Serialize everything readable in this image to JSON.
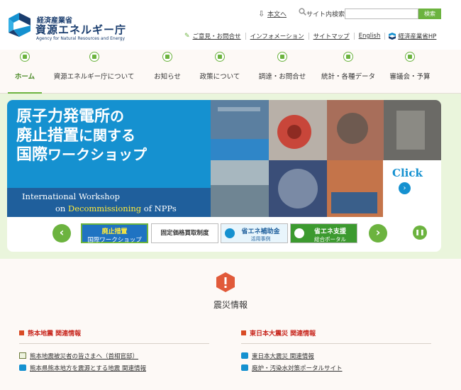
{
  "header": {
    "org_small": "経済産業省",
    "org_main": "資源エネルギー庁",
    "org_en": "Agency for Natural Resources and Energy",
    "skip_link": "本文へ",
    "search_label": "サイト内検索",
    "search_value": "",
    "search_button": "検索"
  },
  "util_links": [
    {
      "label": "ご意見・お問合せ"
    },
    {
      "label": "インフォメーション"
    },
    {
      "label": "サイトマップ"
    },
    {
      "label": "English"
    },
    {
      "label": "経済産業省HP"
    }
  ],
  "nav": [
    {
      "label": "ホーム",
      "active": true
    },
    {
      "label": "資源エネルギー庁について"
    },
    {
      "label": "お知らせ"
    },
    {
      "label": "政策について"
    },
    {
      "label": "調達・お問合せ"
    },
    {
      "label": "統計・各種データ"
    },
    {
      "label": "審議会・予算"
    }
  ],
  "banner": {
    "jp_line1_a": "原子力発電所",
    "jp_line1_b": "の",
    "jp_line2_a": "廃止措置",
    "jp_line2_b": "に関する",
    "jp_line3_a": "国際",
    "jp_line3_b": "ワークショップ",
    "en_line1": "International Workshop",
    "en_line2_a": "on ",
    "en_line2_b": "Decommissioning",
    "en_line2_c": " of NPPs",
    "click_label": "Click"
  },
  "slider": {
    "thumbs": [
      {
        "line1": "廃止措置",
        "line2": "国際ワークショップ"
      },
      {
        "line1": "固定価格買取制度"
      },
      {
        "line1": "省エネ補助金",
        "line2": "活用事例"
      },
      {
        "line1": "省エネ支援",
        "line2": "総合ポータル"
      }
    ]
  },
  "disaster": {
    "title": "震災情報",
    "left": {
      "heading": "熊本地震 関連情報",
      "links": [
        "熊本地震被災者の皆さまへ（首相官邸）",
        "熊本県熊本地方を震源とする地震 関連情報"
      ]
    },
    "right": {
      "heading": "東日本大震災 関連情報",
      "links": [
        "東日本大震災 関連情報",
        "廃炉・汚染水対策ポータルサイト"
      ]
    }
  },
  "colors": {
    "accent": "#6cb33f",
    "brand_blue": "#1591d0",
    "alert_red": "#c8281f"
  }
}
